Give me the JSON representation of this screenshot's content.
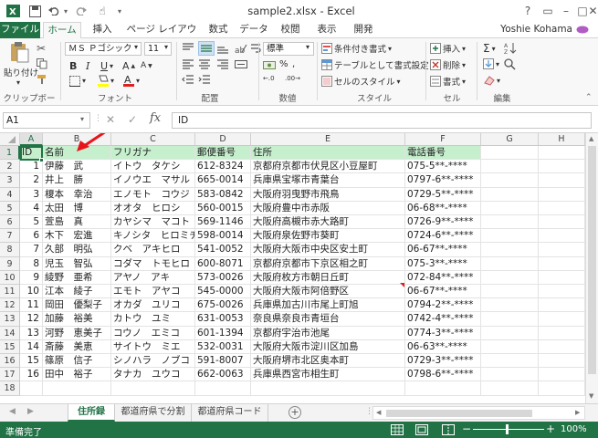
{
  "window": {
    "title": "sample2.xlsx - Excel"
  },
  "ribbon_tabs": [
    "ファイル",
    "ホーム",
    "挿入",
    "ページ レイアウト",
    "数式",
    "データ",
    "校閲",
    "表示",
    "開発"
  ],
  "user": {
    "name": "Yoshie Kohama"
  },
  "ribbon": {
    "paste_label": "貼り付け",
    "clipboard_label": "クリップボード",
    "font_name": "ＭＳ Ｐゴシック",
    "font_size": "11",
    "font_label": "フォント",
    "bold": "B",
    "italic": "I",
    "underline": "U",
    "align_label": "配置",
    "number_format": "標準",
    "number_label": "数値",
    "cond_format": "条件付き書式",
    "table_format": "テーブルとして書式設定",
    "cell_style": "セルのスタイル",
    "style_label": "スタイル",
    "insert": "挿入",
    "delete": "削除",
    "format": "書式",
    "cells_label": "セル",
    "edit_label": "編集"
  },
  "formula_bar": {
    "name_box": "A1",
    "fx": "fx",
    "content": "ID"
  },
  "columns": [
    "A",
    "B",
    "C",
    "D",
    "E",
    "F",
    "G",
    "H"
  ],
  "rows": [
    [
      "ID",
      "名前",
      "フリガナ",
      "郵便番号",
      "住所",
      "電話番号"
    ],
    [
      "1",
      "伊藤　武",
      "イトウ　タケシ",
      "612-8324",
      "京都府京都市伏見区小豆屋町",
      "075-5**-****"
    ],
    [
      "2",
      "井上　勝",
      "イノウエ　マサル",
      "665-0014",
      "兵庫県宝塚市青葉台",
      "0797-6**-****"
    ],
    [
      "3",
      "榎本　幸治",
      "エノモト　コウジ",
      "583-0842",
      "大阪府羽曳野市飛鳥",
      "0729-5**-****"
    ],
    [
      "4",
      "太田　博",
      "オオタ　ヒロシ",
      "560-0015",
      "大阪府豊中市赤阪",
      "06-68**-****"
    ],
    [
      "5",
      "萱島　真",
      "カヤシマ　マコト",
      "569-1146",
      "大阪府高槻市赤大路町",
      "0726-9**-****"
    ],
    [
      "6",
      "木下　宏進",
      "キノシタ　ヒロミチ",
      "598-0014",
      "大阪府泉佐野市葵町",
      "0724-6**-****"
    ],
    [
      "7",
      "久部　明弘",
      "クベ　アキヒロ",
      "541-0052",
      "大阪府大阪市中央区安土町",
      "06-67**-****"
    ],
    [
      "8",
      "児玉　智弘",
      "コダマ　トモヒロ",
      "600-8071",
      "京都府京都市下京区相之町",
      "075-3**-****"
    ],
    [
      "9",
      "綾野　亜希",
      "アヤノ　アキ",
      "573-0026",
      "大阪府枚方市朝日丘町",
      "072-84**-****"
    ],
    [
      "10",
      "江本　綾子",
      "エモト　アヤコ",
      "545-0000",
      "大阪府大阪市阿倍野区",
      "06-67**-****"
    ],
    [
      "11",
      "岡田　優梨子",
      "オカダ　ユリコ",
      "675-0026",
      "兵庫県加古川市尾上町旭",
      "0794-2**-****"
    ],
    [
      "12",
      "加藤　裕美",
      "カトウ　ユミ",
      "631-0053",
      "奈良県奈良市青垣台",
      "0742-4**-****"
    ],
    [
      "13",
      "河野　恵美子",
      "コウノ　エミコ",
      "601-1394",
      "京都府宇治市池尾",
      "0774-3**-****"
    ],
    [
      "14",
      "斎藤　美恵",
      "サイトウ　ミエ",
      "532-0031",
      "大阪府大阪市淀川区加島",
      "06-63**-****"
    ],
    [
      "15",
      "篠原　信子",
      "シノハラ　ノブコ",
      "591-8007",
      "大阪府堺市北区奥本町",
      "0729-3**-****"
    ],
    [
      "16",
      "田中　裕子",
      "タナカ　ユウコ",
      "662-0063",
      "兵庫県西宮市相生町",
      "0798-6**-****"
    ]
  ],
  "row_numbers": [
    "1",
    "2",
    "3",
    "4",
    "5",
    "6",
    "7",
    "8",
    "9",
    "10",
    "11",
    "12",
    "13",
    "14",
    "15",
    "16",
    "17",
    "18"
  ],
  "sheets": [
    "住所録",
    "都道府県で分割",
    "都道府県コード"
  ],
  "status": {
    "ready": "準備完了",
    "zoom": "100%"
  }
}
